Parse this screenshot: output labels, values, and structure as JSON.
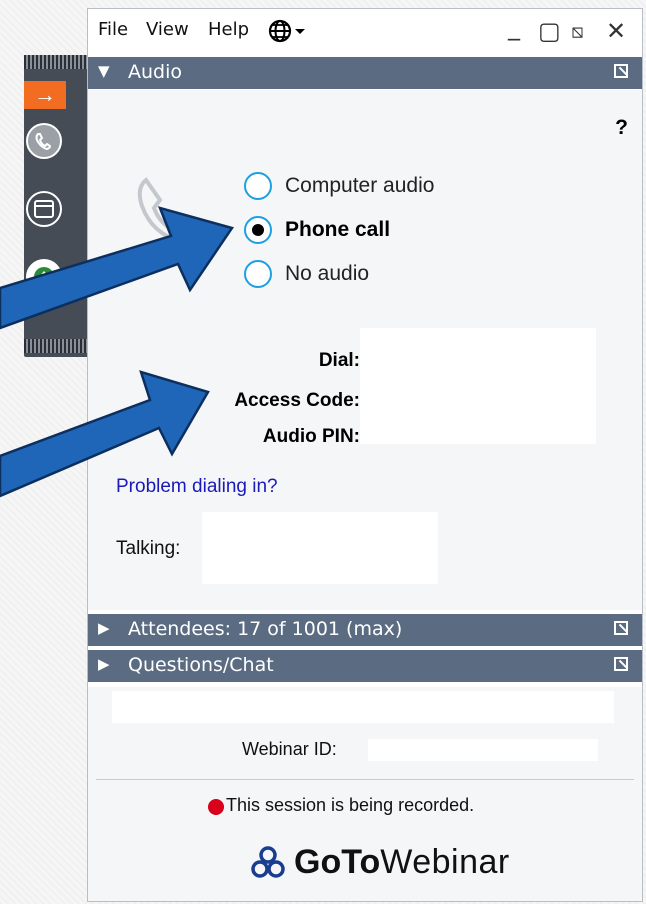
{
  "menu": {
    "file": "File",
    "view": "View",
    "help": "Help"
  },
  "window_controls": {
    "minimize": "_",
    "maximize": "▢",
    "restore": "⧅",
    "close": "✕"
  },
  "audio_panel": {
    "title": "Audio",
    "help": "?",
    "options": [
      {
        "label": "Computer audio",
        "selected": false
      },
      {
        "label": "Phone call",
        "selected": true
      },
      {
        "label": "No audio",
        "selected": false
      }
    ],
    "dial_label": "Dial:",
    "access_code_label": "Access Code:",
    "audio_pin_label": "Audio PIN:",
    "problem_link": "Problem dialing in?",
    "talking_label": "Talking:"
  },
  "attendees_panel": {
    "title": "Attendees:  17 of 1001 (max)"
  },
  "questions_panel": {
    "title": "Questions/Chat"
  },
  "footer": {
    "webinar_id_label": "Webinar ID:",
    "recording_notice": "This session is being recorded.",
    "brand_bold": "GoTo",
    "brand_light": "Webinar"
  },
  "colors": {
    "header_bg": "#5a6b82",
    "radio_border": "#1ca0e0",
    "link": "#1a1ab8",
    "arrow_fill": "#1f66b8",
    "record_dot": "#d9001b",
    "grab_accent": "#f26c22"
  }
}
